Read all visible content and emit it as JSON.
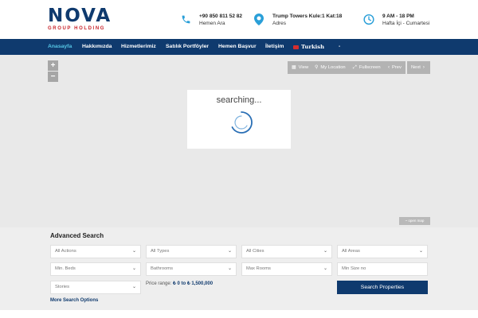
{
  "brand": {
    "name": "NOVA",
    "tagline": "GROUP HOLDING"
  },
  "contacts": [
    {
      "icon": "phone-icon",
      "line1": "+90 850 811 52 82",
      "line2": "Hemen Ara"
    },
    {
      "icon": "location-pin-icon",
      "line1": "Trump Towers Kule:1 Kat:18",
      "line2": "Adres"
    },
    {
      "icon": "clock-icon",
      "line1": "9 AM - 18 PM",
      "line2": "Hafta İçi - Cumartesi"
    }
  ],
  "nav": {
    "items": [
      "Anasayfa",
      "Hakkımızda",
      "Hizmetlerimiz",
      "Satılık Portföyler",
      "Hemen Başvur",
      "İletişim"
    ],
    "language": "Turkish",
    "extra": "-"
  },
  "map": {
    "zoom_in": "+",
    "zoom_out": "−",
    "controls": [
      "View",
      "My Location",
      "Fullscreen",
      "Prev",
      "Next"
    ],
    "loading_text": "searching...",
    "open_map": "~ open map"
  },
  "search": {
    "title": "Advanced Search",
    "fields": {
      "actions": "All Actions",
      "types": "All Types",
      "cities": "All Cities",
      "areas": "All Areas",
      "beds": "Min. Beds",
      "bathrooms": "Bathrooms",
      "max_rooms": "Max Rooms",
      "min_size": "Min Size no",
      "stories": "Stories"
    },
    "price_label": "Price range:",
    "price_value": "₺ 0 to ₺ 1,500,000",
    "button": "Search Properties",
    "more_link": "More Search Options"
  },
  "colors": {
    "primary": "#0f3a6e",
    "accent": "#57c7e6",
    "brand_red": "#c8222a"
  }
}
